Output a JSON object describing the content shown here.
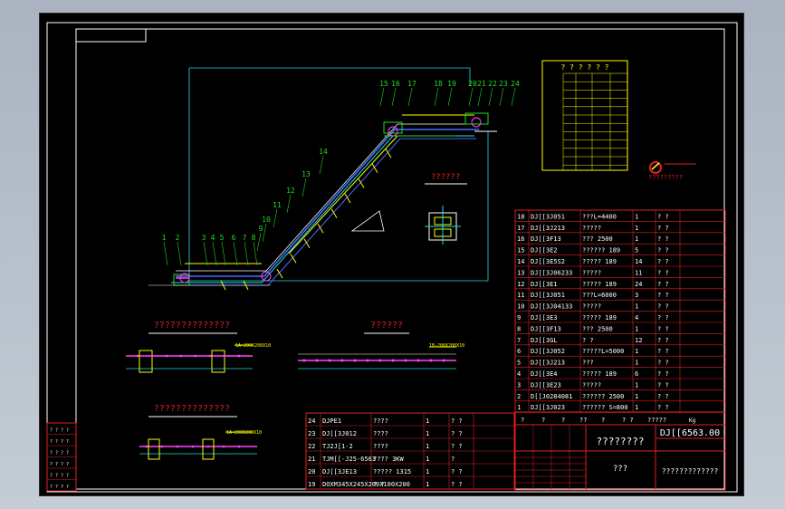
{
  "colors": {
    "frame": "#ffffff",
    "red": "#e02020",
    "yellow": "#ffff00",
    "green": "#22dd22",
    "cyan": "#22dddd",
    "blue": "#4a6cff",
    "magenta": "#ff44ff",
    "white": "#ffffff"
  },
  "title_block": {
    "name_box": "????????",
    "drawing_no": "DJ[[6563.00",
    "scale": "???",
    "company": "?????????????",
    "weight_unit": "Kg",
    "header_cells": [
      "?",
      "?",
      "?",
      "??",
      "?",
      "? ?",
      "?????"
    ]
  },
  "view_titles": {
    "side_view": "??????????????",
    "bottom_view": "??????????????",
    "section_a": "??????",
    "section_small": "??????"
  },
  "section_notes": {
    "s1": "1A-200X200X10",
    "s2": "1B-200X200X10",
    "s3": "1A-200X200X10"
  },
  "callouts": [
    "1",
    "2",
    "3",
    "4",
    "5",
    "6",
    "7",
    "8",
    "9",
    "10",
    "11",
    "12",
    "13",
    "14",
    "15",
    "16",
    "17",
    "18",
    "19",
    "20",
    "21",
    "22",
    "23",
    "24"
  ],
  "parameter_table": {
    "title": "? ? ? ? ? ?",
    "logo_caption": "?????????"
  },
  "parts_right": [
    {
      "no": "18",
      "code": "DJ[[3J051",
      "name": "???L=4400",
      "qty": "1",
      "mat": "? ?"
    },
    {
      "no": "17",
      "code": "DJ[[3J213",
      "name": "?????",
      "qty": "1",
      "mat": "? ?"
    },
    {
      "no": "16",
      "code": "DJ[[3F13",
      "name": "??? 2500",
      "qty": "1",
      "mat": "? ?"
    },
    {
      "no": "15",
      "code": "DJ[[3E2",
      "name": "?????? 189",
      "qty": "5",
      "mat": "? ?"
    },
    {
      "no": "14",
      "code": "DJ[[3E5S2",
      "name": "????? 189",
      "qty": "14",
      "mat": "? ?"
    },
    {
      "no": "13",
      "code": "DJ[[3J06233",
      "name": "?????",
      "qty": "11",
      "mat": "? ?"
    },
    {
      "no": "12",
      "code": "DJ[[3E1",
      "name": "????? 189",
      "qty": "24",
      "mat": "? ?"
    },
    {
      "no": "11",
      "code": "DJ[[3J051",
      "name": "???L=6000",
      "qty": "3",
      "mat": "? ?"
    },
    {
      "no": "10",
      "code": "DJ[[3J04133",
      "name": "?????",
      "qty": "1",
      "mat": "? ?"
    },
    {
      "no": "9",
      "code": "DJ[[3E3",
      "name": "????? 189",
      "qty": "4",
      "mat": "? ?"
    },
    {
      "no": "8",
      "code": "DJ[[3F13",
      "name": "??? 2500",
      "qty": "1",
      "mat": "? ?"
    },
    {
      "no": "7",
      "code": "DJ[[3GL",
      "name": "? ?",
      "qty": "12",
      "mat": "? ?"
    },
    {
      "no": "6",
      "code": "DJ[[3J052",
      "name": "?????L=5000",
      "qty": "1",
      "mat": "? ?"
    },
    {
      "no": "5",
      "code": "DJ[[3J213",
      "name": "???",
      "qty": "1",
      "mat": "? ?"
    },
    {
      "no": "4",
      "code": "DJ[[3E4",
      "name": "????? 189",
      "qty": "6",
      "mat": "? ?"
    },
    {
      "no": "3",
      "code": "DJ[[3E23",
      "name": "?????",
      "qty": "1",
      "mat": "? ?"
    },
    {
      "no": "2",
      "code": "D[[J0284081",
      "name": "?????? 2500",
      "qty": "1",
      "mat": "? ?"
    },
    {
      "no": "1",
      "code": "DJ[[3J023",
      "name": "?????? S=800",
      "qty": "1",
      "mat": "? ?"
    }
  ],
  "parts_left": [
    {
      "no": "24",
      "code": "DJPE1",
      "name": "????",
      "qty": "1",
      "mat": "? ?"
    },
    {
      "no": "23",
      "code": "DJ[[3J012",
      "name": "????",
      "qty": "1",
      "mat": "? ?"
    },
    {
      "no": "22",
      "code": "TJ2J[1-2",
      "name": "????",
      "qty": "1",
      "mat": "? ?"
    },
    {
      "no": "21",
      "code": "TJM[[-J25-6563",
      "name": "???? 3KW",
      "qty": "1",
      "mat": "?"
    },
    {
      "no": "20",
      "code": "DJ[[3JE13",
      "name": "????? 1315",
      "qty": "1",
      "mat": "? ?"
    },
    {
      "no": "19",
      "code": "DOXM345X245X200X100X200",
      "name": "? ?",
      "qty": "1",
      "mat": "? ?"
    }
  ],
  "small_block_rows": [
    "? ? ? ?",
    "? ? ? ?",
    "? ? ? ?",
    "? ? ? ?",
    "? ? ? ?",
    "? ? ? ?"
  ]
}
